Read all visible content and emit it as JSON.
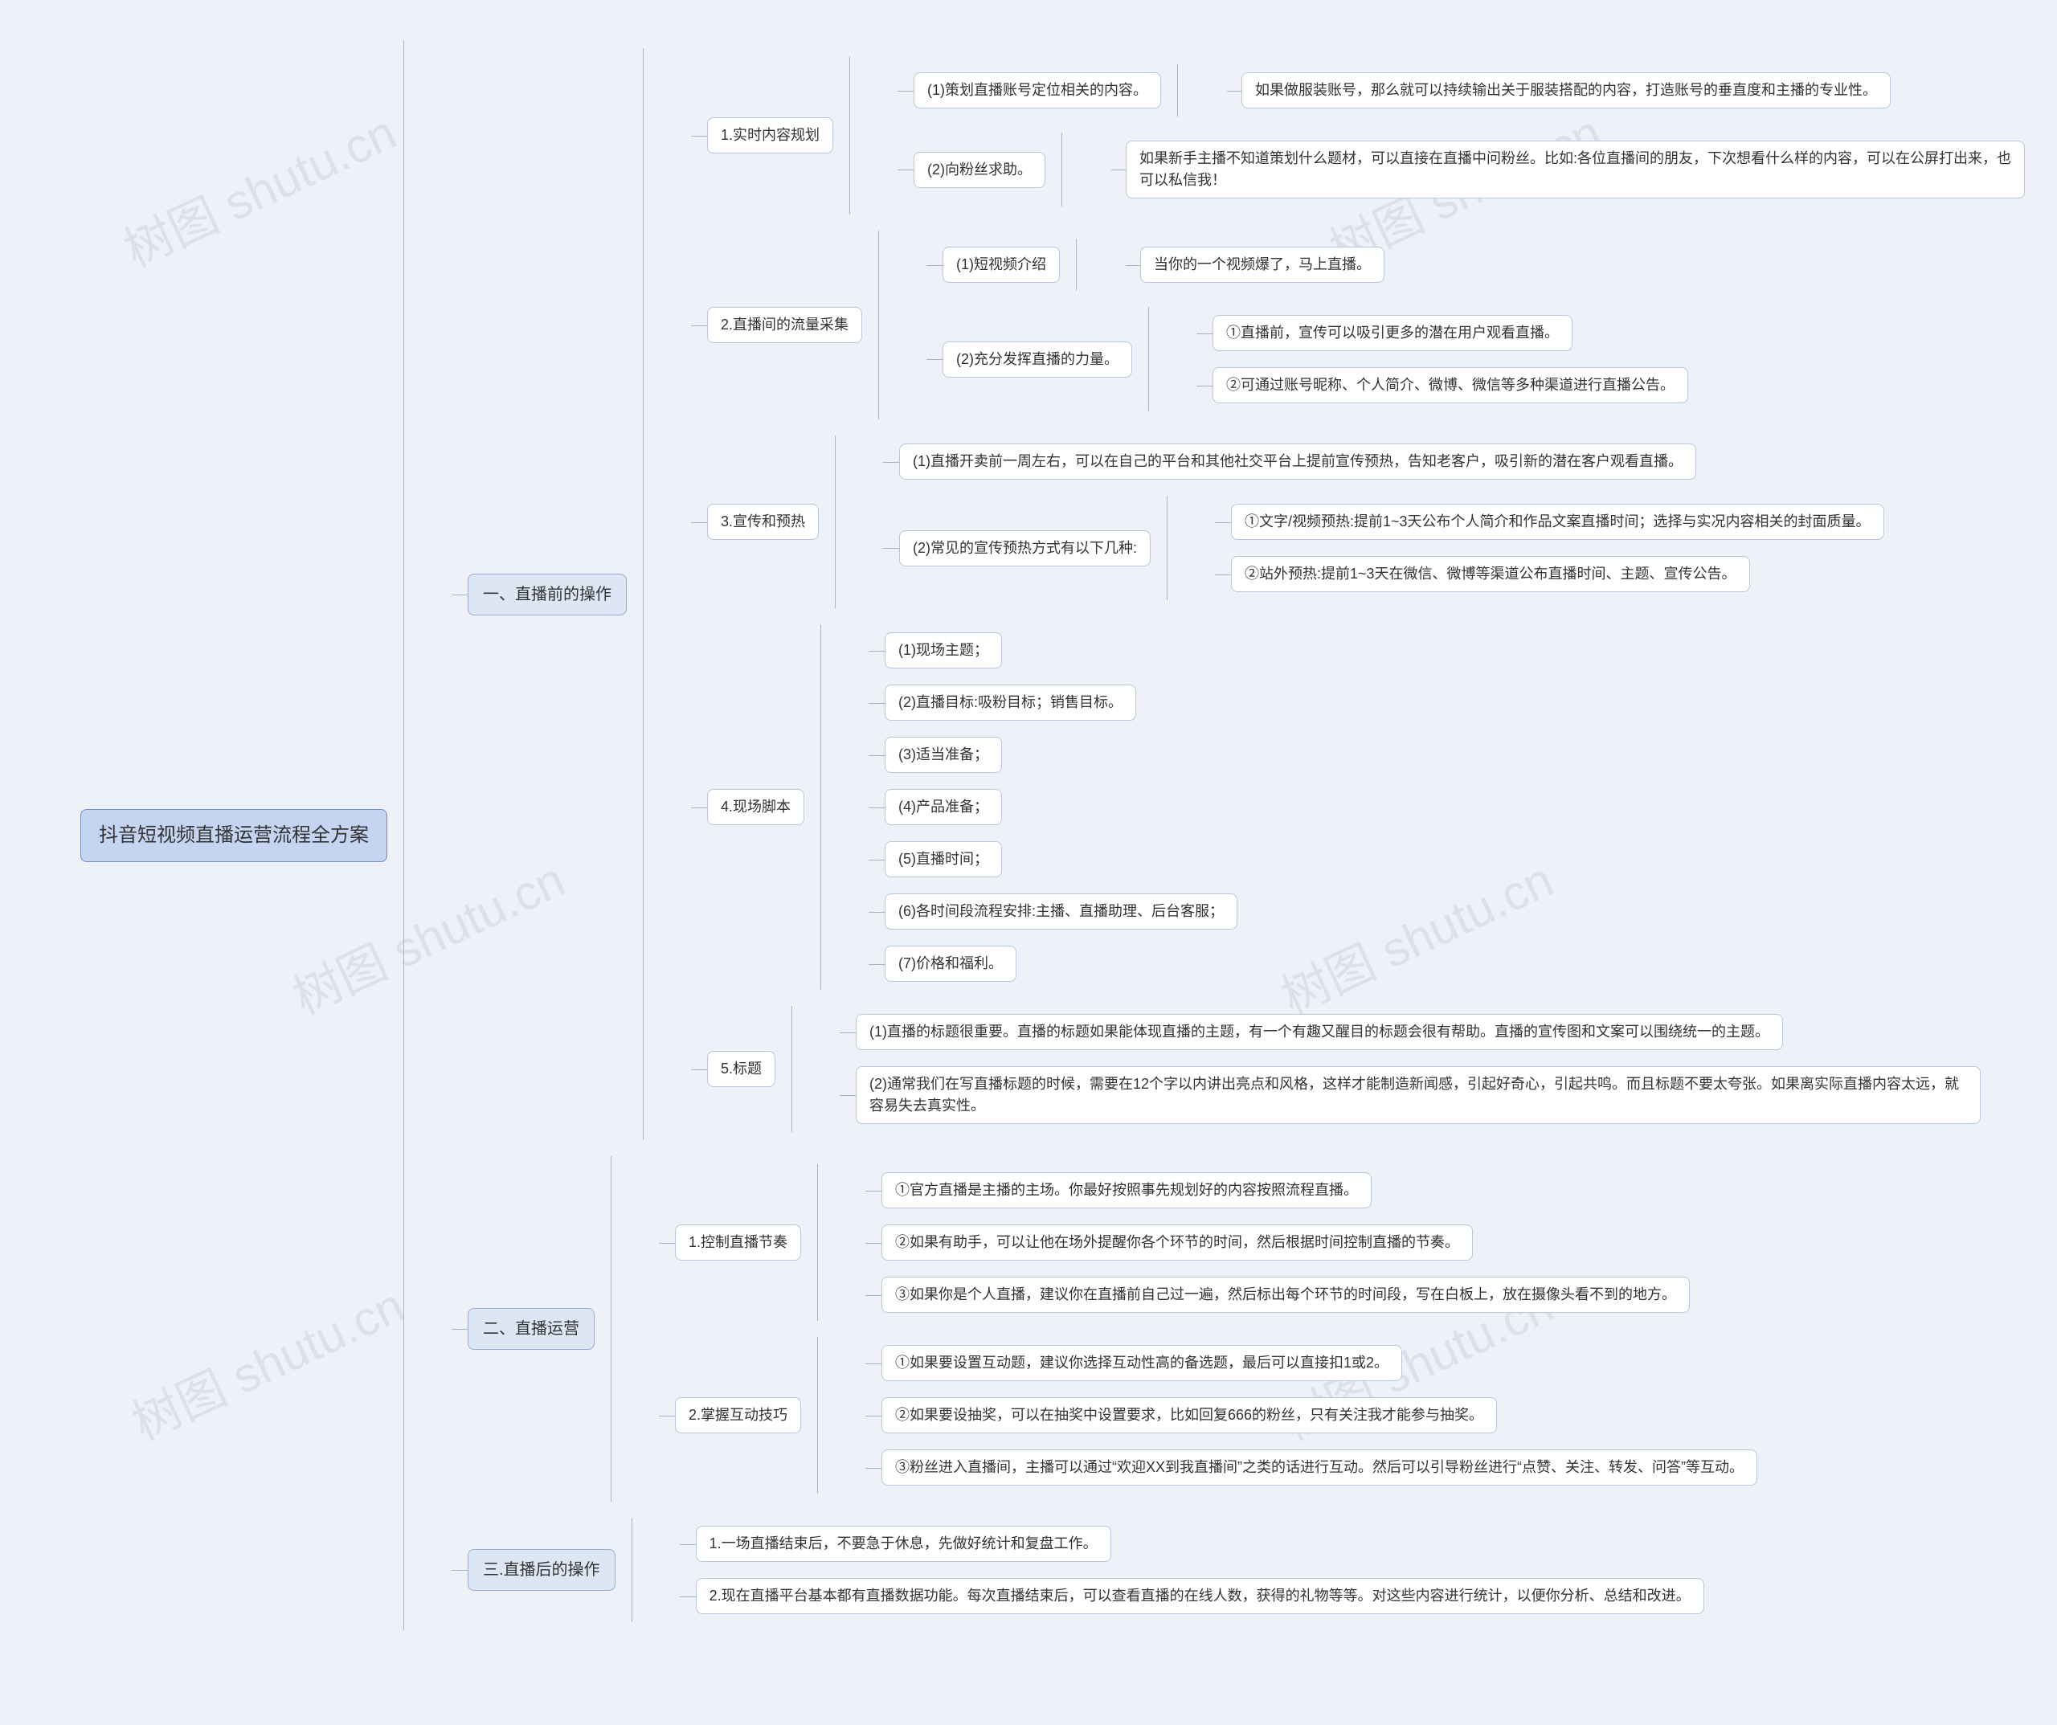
{
  "root": "抖音短视频直播运营流程全方案",
  "watermark": "树图 shutu.cn",
  "sections": [
    {
      "title": "一、直播前的操作",
      "items": [
        {
          "title": "1.实时内容规划",
          "children": [
            {
              "title": "(1)策划直播账号定位相关的内容。",
              "detail": "如果做服装账号，那么就可以持续输出关于服装搭配的内容，打造账号的垂直度和主播的专业性。"
            },
            {
              "title": "(2)向粉丝求助。",
              "detail": "如果新手主播不知道策划什么题材，可以直接在直播中问粉丝。比如:各位直播间的朋友，下次想看什么样的内容，可以在公屏打出来，也可以私信我！"
            }
          ]
        },
        {
          "title": "2.直播间的流量采集",
          "children": [
            {
              "title": "(1)短视频介绍",
              "detail": "当你的一个视频爆了，马上直播。"
            },
            {
              "title": "(2)充分发挥直播的力量。",
              "sub": [
                "①直播前，宣传可以吸引更多的潜在用户观看直播。",
                "②可通过账号昵称、个人简介、微博、微信等多种渠道进行直播公告。"
              ]
            }
          ]
        },
        {
          "title": "3.宣传和预热",
          "children": [
            {
              "title": "(1)直播开卖前一周左右，可以在自己的平台和其他社交平台上提前宣传预热，告知老客户，吸引新的潜在客户观看直播。"
            },
            {
              "title": "(2)常见的宣传预热方式有以下几种:",
              "sub": [
                "①文字/视频预热:提前1~3天公布个人简介和作品文案直播时间；选择与实况内容相关的封面质量。",
                "②站外预热:提前1~3天在微信、微博等渠道公布直播时间、主题、宣传公告。"
              ]
            }
          ]
        },
        {
          "title": "4.现场脚本",
          "children": [
            {
              "title": "(1)现场主题；"
            },
            {
              "title": "(2)直播目标:吸粉目标；销售目标。"
            },
            {
              "title": "(3)适当准备；"
            },
            {
              "title": "(4)产品准备；"
            },
            {
              "title": "(5)直播时间；"
            },
            {
              "title": "(6)各时间段流程安排:主播、直播助理、后台客服；"
            },
            {
              "title": "(7)价格和福利。"
            }
          ]
        },
        {
          "title": "5.标题",
          "children": [
            {
              "title": "(1)直播的标题很重要。直播的标题如果能体现直播的主题，有一个有趣又醒目的标题会很有帮助。直播的宣传图和文案可以围绕统一的主题。"
            },
            {
              "title": "(2)通常我们在写直播标题的时候，需要在12个字以内讲出亮点和风格，这样才能制造新闻感，引起好奇心，引起共鸣。而且标题不要太夸张。如果离实际直播内容太远，就容易失去真实性。"
            }
          ]
        }
      ]
    },
    {
      "title": "二、直播运营",
      "items": [
        {
          "title": "1.控制直播节奏",
          "children": [
            {
              "title": "①官方直播是主播的主场。你最好按照事先规划好的内容按照流程直播。"
            },
            {
              "title": "②如果有助手，可以让他在场外提醒你各个环节的时间，然后根据时间控制直播的节奏。"
            },
            {
              "title": "③如果你是个人直播，建议你在直播前自己过一遍，然后标出每个环节的时间段，写在白板上，放在摄像头看不到的地方。"
            }
          ]
        },
        {
          "title": "2.掌握互动技巧",
          "children": [
            {
              "title": "①如果要设置互动题，建议你选择互动性高的备选题，最后可以直接扣1或2。"
            },
            {
              "title": "②如果要设抽奖，可以在抽奖中设置要求，比如回复666的粉丝，只有关注我才能参与抽奖。"
            },
            {
              "title": "③粉丝进入直播间，主播可以通过“欢迎XX到我直播间”之类的话进行互动。然后可以引导粉丝进行“点赞、关注、转发、问答”等互动。"
            }
          ]
        }
      ]
    },
    {
      "title": "三.直播后的操作",
      "items": [
        {
          "title": "1.一场直播结束后，不要急于休息，先做好统计和复盘工作。"
        },
        {
          "title": "2.现在直播平台基本都有直播数据功能。每次直播结束后，可以查看直播的在线人数，获得的礼物等等。对这些内容进行统计，以便你分析、总结和改进。"
        }
      ]
    }
  ]
}
